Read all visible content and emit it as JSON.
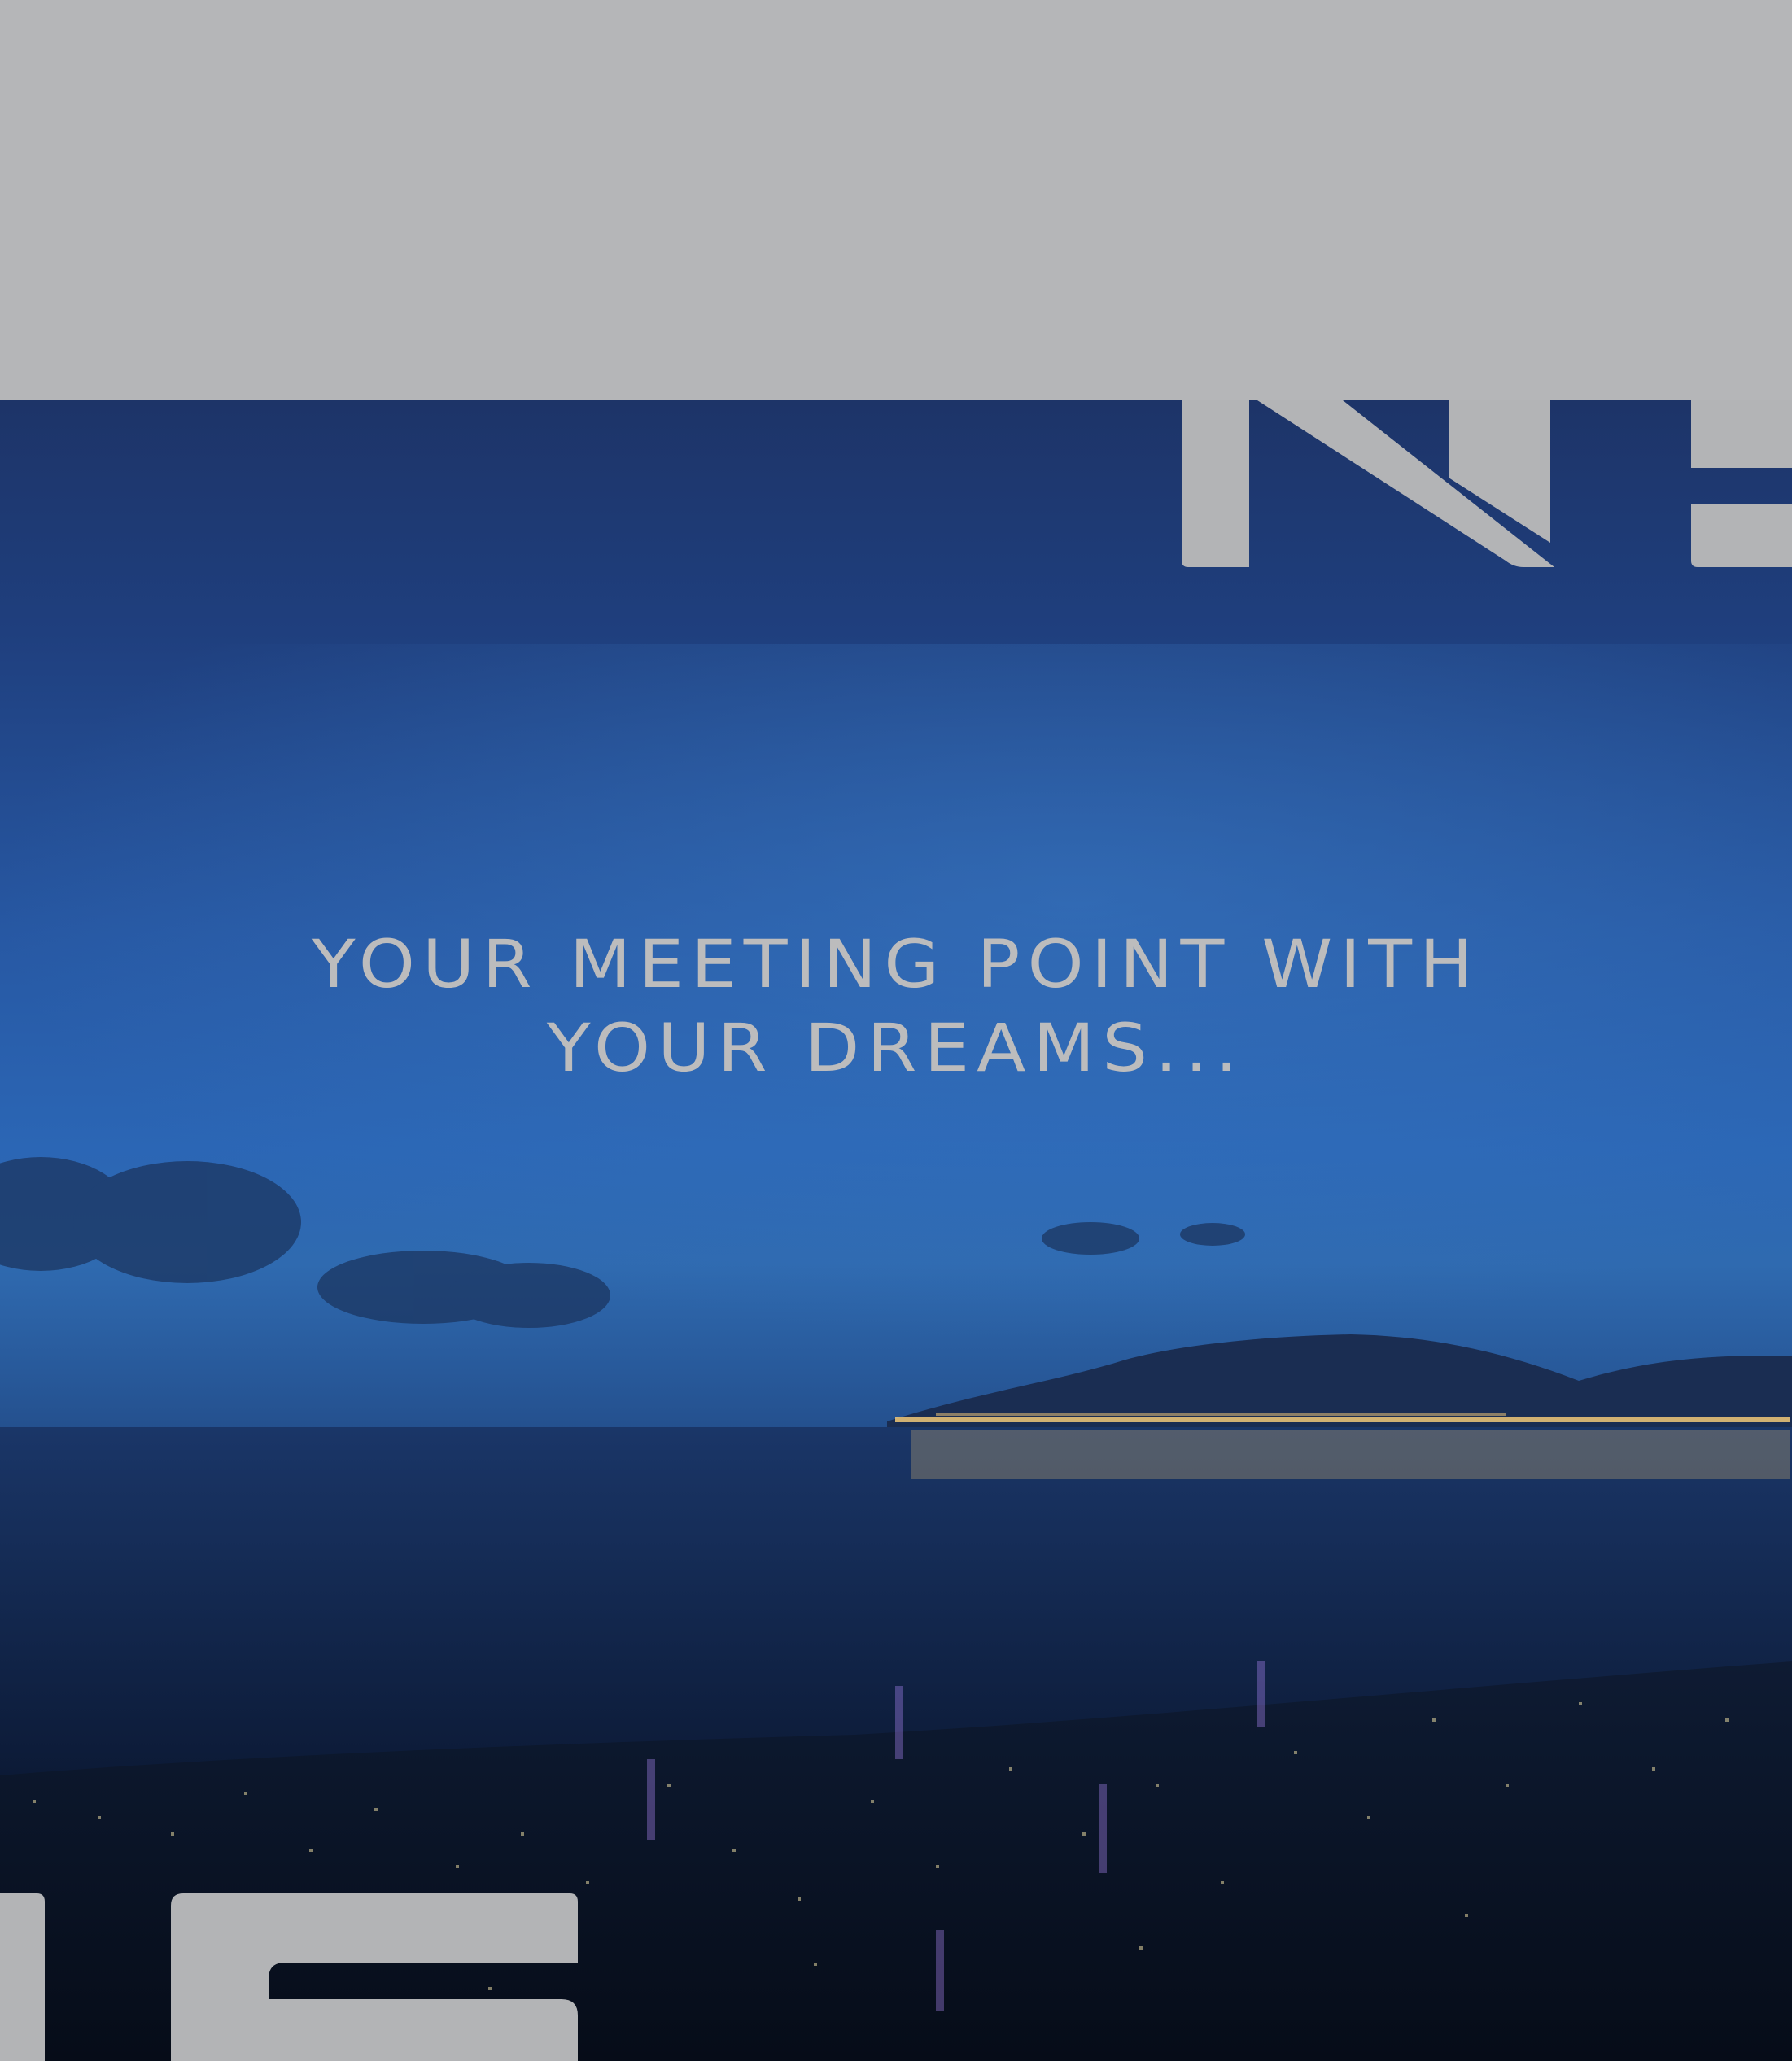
{
  "tagline": {
    "line1": "YOUR MEETING POINT WITH",
    "line2": "YOUR DREAMS..."
  },
  "colors": {
    "band_gray": "#b5b6b8",
    "letter_gray": "#b3b4b6",
    "sky_top": "#1d3468",
    "sky_mid": "#2b66b5",
    "sea": "#0f1f3d",
    "city_light": "#ffd27a"
  }
}
